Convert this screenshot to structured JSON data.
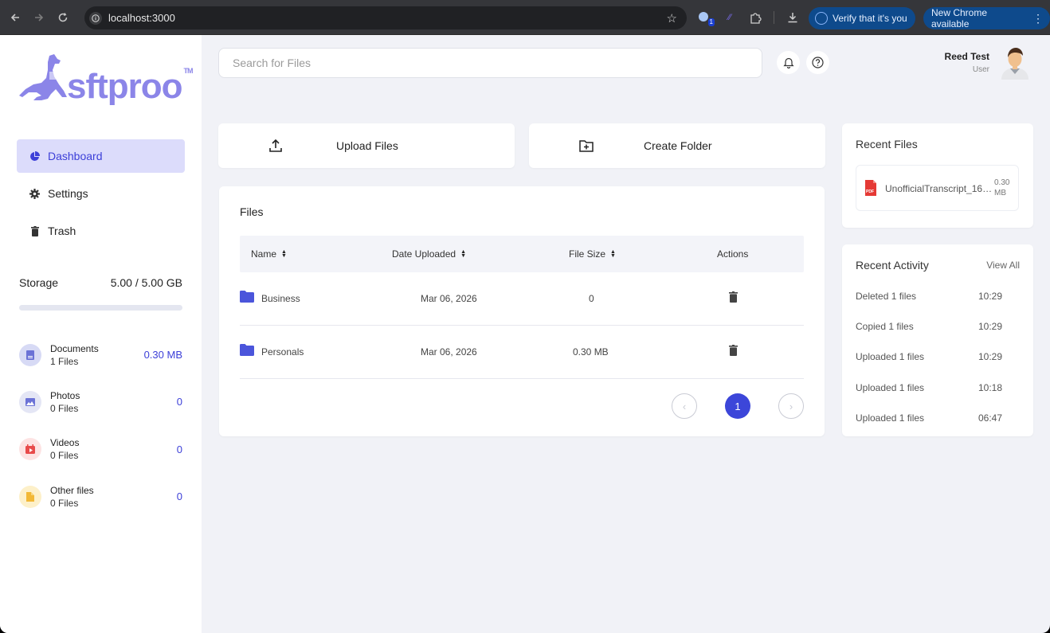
{
  "browser": {
    "url": "localhost:3000",
    "extension_badge": "1",
    "verify_label": "Verify that it's you",
    "update_label": "New Chrome available"
  },
  "sidebar": {
    "logo_text": "sftproo",
    "logo_tm": "TM",
    "menu": [
      {
        "label": "Dashboard",
        "icon": "pie-chart-icon",
        "active": true
      },
      {
        "label": "Settings",
        "icon": "gear-icon",
        "active": false
      },
      {
        "label": "Trash",
        "icon": "trash-icon",
        "active": false
      }
    ],
    "storage": {
      "label": "Storage",
      "value": "5.00 / 5.00 GB",
      "used_fraction": 0.0
    },
    "categories": [
      {
        "name": "Documents",
        "count": "1 Files",
        "size": "0.30 MB",
        "icon": "document-icon",
        "color": "#d7daf5",
        "icon_color": "#6b72d6"
      },
      {
        "name": "Photos",
        "count": "0 Files",
        "size": "0",
        "icon": "image-icon",
        "color": "#e4e6f5",
        "icon_color": "#6b72d6"
      },
      {
        "name": "Videos",
        "count": "0 Files",
        "size": "0",
        "icon": "video-icon",
        "color": "#fde3e3",
        "icon_color": "#e84b4b"
      },
      {
        "name": "Other files",
        "count": "0 Files",
        "size": "0",
        "icon": "file-icon",
        "color": "#fdf0c9",
        "icon_color": "#f2b835"
      }
    ]
  },
  "header": {
    "search_placeholder": "Search for Files",
    "user_name": "Reed Test",
    "user_role": "User"
  },
  "actions": {
    "upload_label": "Upload Files",
    "create_folder_label": "Create Folder"
  },
  "files": {
    "title": "Files",
    "columns": [
      "Name",
      "Date Uploaded",
      "File Size",
      "Actions"
    ],
    "rows": [
      {
        "name": "Business",
        "date": "Mar 06, 2026",
        "size": "0"
      },
      {
        "name": "Personals",
        "date": "Mar 06, 2026",
        "size": "0.30 MB"
      }
    ],
    "current_page": "1"
  },
  "recent_files": {
    "title": "Recent Files",
    "items": [
      {
        "name": "UnofficialTranscript_169...",
        "size": "0.30 MB"
      }
    ]
  },
  "recent_activity": {
    "title": "Recent Activity",
    "view_all": "View All",
    "items": [
      {
        "text": "Deleted 1 files",
        "time": "10:29"
      },
      {
        "text": "Copied 1 files",
        "time": "10:29"
      },
      {
        "text": "Uploaded 1 files",
        "time": "10:29"
      },
      {
        "text": "Uploaded 1 files",
        "time": "10:18"
      },
      {
        "text": "Uploaded 1 files",
        "time": "06:47"
      }
    ]
  }
}
